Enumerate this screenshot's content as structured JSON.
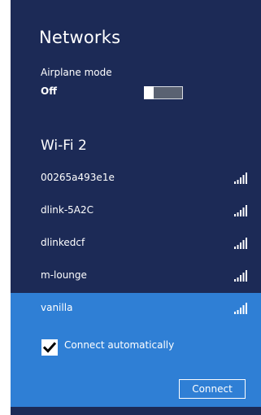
{
  "header": {
    "title": "Networks"
  },
  "airplane": {
    "label": "Airplane mode",
    "state": "Off"
  },
  "wifi": {
    "group_label": "Wi-Fi 2",
    "networks": [
      {
        "name": "00265a493e1e",
        "signal_icon": "signal-bars-icon"
      },
      {
        "name": "dlink-5A2C",
        "signal_icon": "signal-bars-icon"
      },
      {
        "name": "dlinkedcf",
        "signal_icon": "signal-bars-icon"
      },
      {
        "name": "m-lounge",
        "signal_icon": "signal-bars-icon"
      },
      {
        "name": "vanilla",
        "signal_icon": "signal-bars-icon",
        "selected": true
      }
    ],
    "connect_automatically_label": "Connect automatically",
    "connect_automatically_checked": true,
    "connect_button_label": "Connect"
  },
  "colors": {
    "panel_bg": "#1c2a56",
    "selected_bg": "#2f7fd5",
    "text": "#ffffff"
  }
}
